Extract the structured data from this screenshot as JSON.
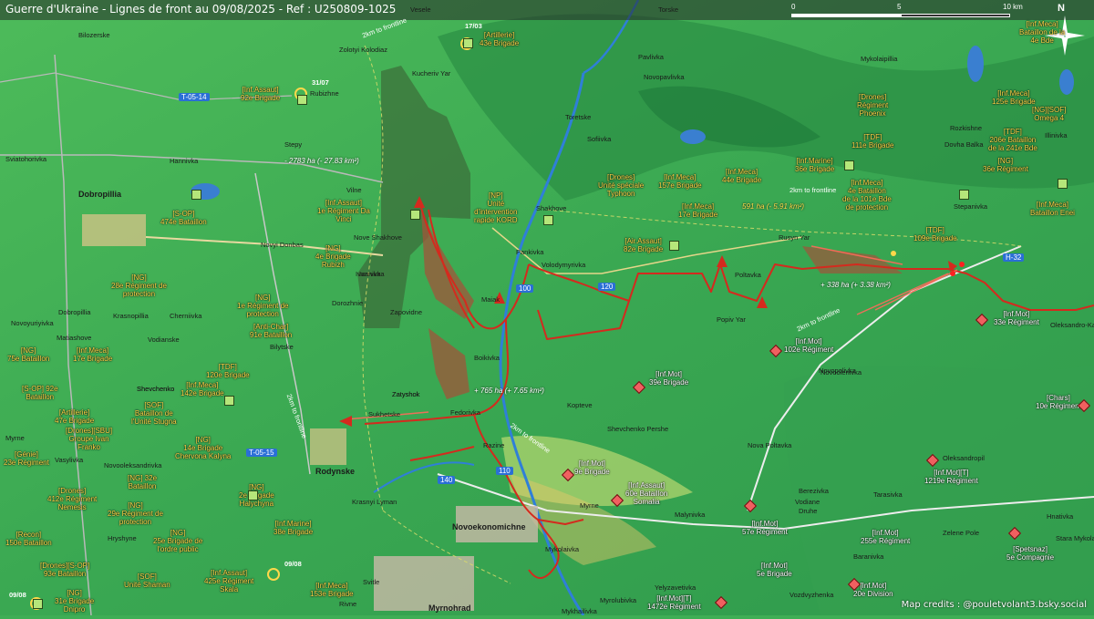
{
  "title": "Guerre d'Ukraine - Lignes de front au 09/08/2025 - Ref : U250809-1025",
  "credits": "Map credits : @pouletvolant3.bsky.social",
  "scale": {
    "zero": "0",
    "mid": "5",
    "max": "10 km"
  },
  "north": "N",
  "areas": {
    "a1": "- 2783 ha (- 27.83 km²)",
    "a2": "591 ha (- 5.91 km²)",
    "a3": "+ 338 ha (+ 3.38 km²)",
    "a4": "+ 765 ha (+ 7.65 km²)"
  },
  "roads": {
    "r1": "T-05-14",
    "r2": "T-05-15",
    "r3": "H-32",
    "r4": "100",
    "r5": "120",
    "r6": "140",
    "r7": "110"
  },
  "places": {
    "p1": "Bilozerske",
    "p2": "Dobropillia",
    "p3": "Rodynske",
    "p4": "Novoekonomichne",
    "p5": "Myrnohrad",
    "p6": "Shakhove",
    "p7": "Pankivka",
    "p8": "Volodymyrivka",
    "p9": "Poltavka",
    "p10": "Rusyn Yar",
    "p11": "Maiak",
    "p12": "Boikivka",
    "p13": "Zapovidne",
    "p14": "Zatyshok",
    "p15": "Fedorivka",
    "p16": "Razine",
    "p17": "Myrne",
    "p18": "Mykolaivka",
    "p19": "Malynivka",
    "p20": "Kopteve",
    "p21": "Shevchenko Pershe",
    "p22": "Nova Poltavka",
    "p23": "Novopolivka",
    "p24": "Torske",
    "p25": "Kucheriv Yar",
    "p26": "Zolotyi Kolodiaz",
    "p27": "Rubizhne",
    "p28": "Stepy",
    "p29": "Hannivka",
    "p30": "Nove Shakhove",
    "p31": "Ivanivka",
    "p32": "Dorozhnie",
    "p33": "Sukhetske",
    "p34": "Krasnyi Lyman",
    "p35": "Popiv Yar",
    "p36": "Stepanivka",
    "p37": "Pavlivka",
    "p38": "Toretske",
    "p39": "Sofiivka",
    "p40": "Novopavlivka",
    "p41": "Mykolaipillia",
    "p42": "Vesele",
    "p43": "Sviatohorivka",
    "p44": "Novyi Donbas",
    "p45": "Vilne",
    "p46": "Novoolenivka",
    "p47": "Zatyshok",
    "p48": "Berezivka",
    "p49": "Vodiane",
    "p50": "Druhe",
    "p51": "Tarasivka",
    "p52": "Oleksandropil",
    "p53": "Zelene Pole",
    "p54": "Baranivka",
    "p55": "Vozdvyzhenka",
    "p56": "Yelyzavetivka",
    "p57": "Mykhailivka",
    "p58": "Myrolubivka",
    "p59": "Svitle",
    "p60": "Rivne",
    "p61": "Krasnopillia",
    "p62": "Bilytske",
    "p63": "Vodianske",
    "p64": "Novoyuriyivka",
    "p65": "Shevchenko",
    "p66": "Matiashove",
    "p67": "Hryshyne",
    "p68": "Shevchenko",
    "p69": "Novooleksandrivka",
    "p70": "Vasylivka",
    "p71": "Myrne",
    "p72": "Rozkishne",
    "p73": "Dovha Balka",
    "p74": "Illinivka",
    "p75": "Dobropillia",
    "p76": "Ivanivka",
    "p77": "Cherniivka",
    "p78": "Hnativka",
    "p79": "Stara Mykolaivka",
    "p80": "Oleksandro-Kalynove"
  },
  "units": {
    "u1": "[Artillerie]\n43e Brigade",
    "u2": "[Inf.Assaut]\n92e Brigade",
    "u3": "[S-OP]\n474e Bataillon",
    "u4": "[Inf.Assaut]\n1e Régiment Da\nVinci",
    "u5": "[NP]\nUnité\nd'intervention\nrapide KORD",
    "u6": "[NG]\n4e Brigade\nRubizh",
    "u7": "[NG]\n28e Régiment de\nprotection",
    "u8": "[NG]\n1e Régiment de\nprotection",
    "u9": "[Anti-Char]\n91e Bataillon",
    "u10": "[NG]\n75e Bataillon",
    "u11": "[Inf.Meca]\n17e Brigade",
    "u12": "[TDF]\n120e Brigade",
    "u13": "[S-OP] 92e\nBataillon",
    "u14": "[Inf.Meca]\n142e Brigade",
    "u15": "[Artillerie]\n47e Brigade",
    "u16": "[SOF]\nBataillon de\nl'Unité Stugna",
    "u17": "[Drones][SBU]\nGroupe Ivan\nFranko",
    "u18": "[NG]\n14e Brigade\nChervona Kalyna",
    "u19": "[Génie]\n23e Régiment",
    "u20": "[NG] 32e\nBataillon",
    "u21": "[Drones]\n412e Régiment\nNemesis",
    "u22": "[NG]\n29e Régiment de\nprotection",
    "u23": "[NG]\n2e Brigade\nHalychyna",
    "u24": "[Recon]\n150e Bataillon",
    "u25": "[NG]\n25e Brigade de\nl'ordre public",
    "u26": "[Inf.Marine]\n38e Brigade",
    "u27": "[Drones][S-OP]\n93e Bataillon",
    "u28": "[SOF]\nUnité Shaman",
    "u29": "[Inf.Assaut]\n425e Régiment\nSkala",
    "u30": "[Inf.Meca]\n153e Brigade",
    "u31": "[NG]\n31e Brigade\nDnipro",
    "u32": "[Drones]\nUnité spéciale\nTyphoon",
    "u33": "[Inf.Meca]\n157e Brigade",
    "u34": "[Inf.Meca]\n44e Brigade",
    "u35": "[Inf.Meca]\n17e Brigade",
    "u36": "[Air.Assaut]\n82e Brigade",
    "u37": "[Inf.Marine]\n36e Brigade",
    "u38": "[Inf.Meca]\n4e Bataillon\nde la 101e Bde\nde protection",
    "u39": "[Drones]\nRégiment\nPhoenix",
    "u40": "[TDF]\n111e Brigade",
    "u41": "[TDF]\n109e Brigade",
    "u42": "[Inf.Meca]\n125e Brigade",
    "u43": "[TDF]\n206e Bataillon\nde la 241e Bde",
    "u44": "[NG]\n36e Régiment",
    "u45": "[NG][SOF]\nOmega 4",
    "u46": "[Inf.Meca]\nBataillon Enei",
    "u47": "[Inf.Meca]\nBataillon de la\n4e Bde",
    "r1": "[Inf.Mot]\n39e Brigade",
    "r2": "[Inf.Mot]\n102e Régiment",
    "r3": "[Inf.Mot]\n9e Brigade",
    "r4": "[Inf.Assaut]\n60e Bataillon\nSomalia",
    "r5": "[Inf.Mot]\n57e Régiment",
    "r6": "[Inf.Mot]\n5e Brigade",
    "r7": "[Inf.Mot][T]\n1472e Régiment",
    "r8": "[Inf.Mot]\n255e Régiment",
    "r9": "[Inf.Mot]\n20e Division",
    "r10": "[Inf.Mot][T]\n1219e Régiment",
    "r11": "[Spetsnaz]\n5e Compagnie",
    "r12": "[Chars]\n10e Régiment",
    "r13": "[Inf.Mot]\n33e Régiment"
  },
  "dates": {
    "d1": "17/03",
    "d2": "31/07",
    "d3": "09/08",
    "d4": "09/08"
  },
  "frontlabels": {
    "f1": "2km to frontline",
    "f2": "2km to frontline",
    "f3": "2km to frontline",
    "f4": "2km to frontline",
    "f5": "2km to frontline"
  },
  "colors": {
    "front": "#d42a1e",
    "ua_unit": "#ffd84a",
    "ru_unit": "#ffffff",
    "terrain": "#3fae55"
  }
}
